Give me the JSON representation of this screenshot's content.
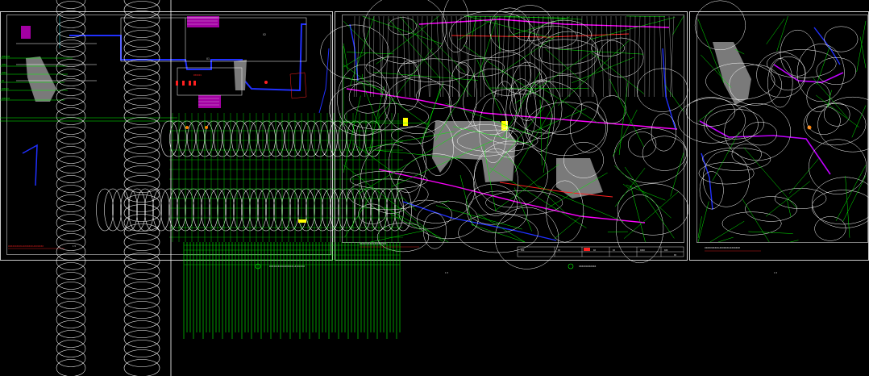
{
  "colors": {
    "background": "#000000",
    "frame": "#ffffff",
    "primary_linework": "#ffffff",
    "dimension_lines": "#00ff00",
    "boundary": "#0000ff",
    "red_marks": "#ff0000",
    "magenta_hatch": "#ff00ff",
    "grey_fill": "#808080",
    "yellow_marks": "#ffff00",
    "orange_marks": "#ff8000"
  },
  "sheets": {
    "left": {
      "block_numbers": [
        "02",
        "01"
      ],
      "label_a": "RS5001",
      "caption": "XXXXXXXXXX-XXXXXXX-XXXXXXX",
      "scale": "1:5"
    },
    "middle": {
      "caption_left": "XXXXXXXXXX-XXXXXXX-XXXXXXX",
      "caption_right": "XXXXXXXXXX-XXXX-XXXX",
      "scale": "1:5",
      "panel_mid_label": "XXXXXXXXXXXX",
      "table_cells": [
        "XXX",
        "XX",
        "XX",
        "XX",
        "XXXX",
        "XXX",
        "XX"
      ]
    },
    "right": {
      "caption": "XXXXXXXXXX-XXXXXXX-XXXXXXX",
      "scale": "1:5"
    }
  },
  "icons": [
    "circle-marker-icon",
    "detail-callout-icon"
  ]
}
